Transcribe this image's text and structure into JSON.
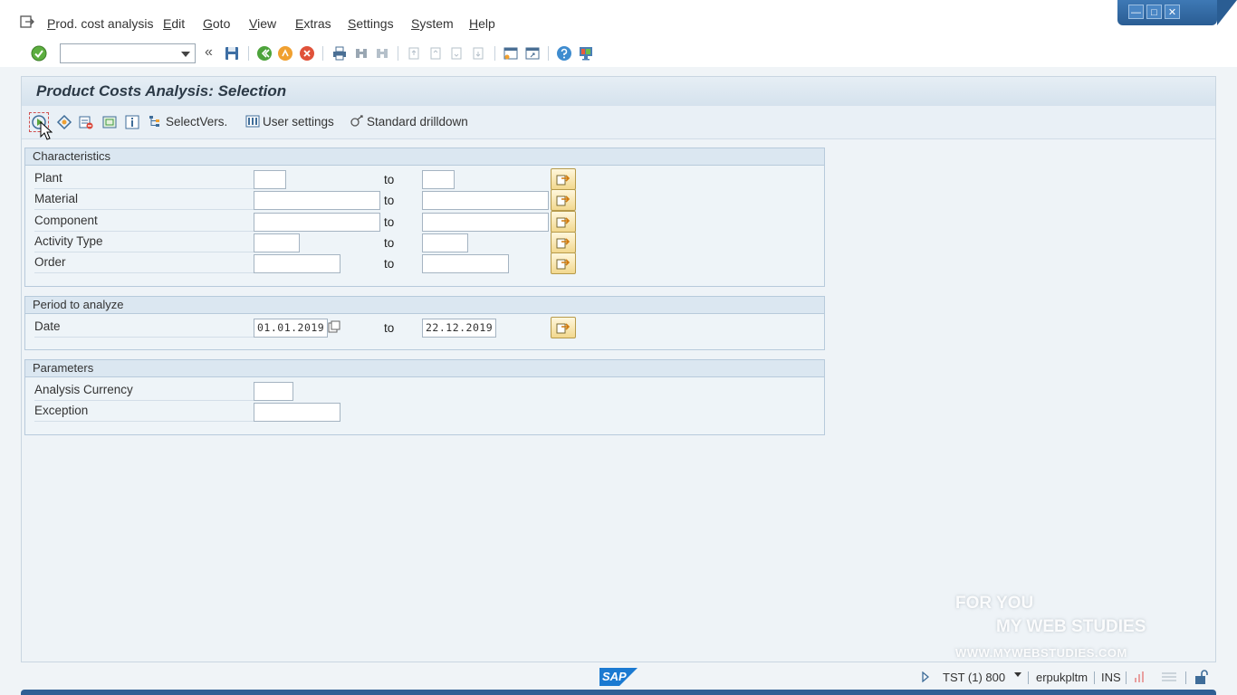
{
  "menubar": {
    "items": [
      "Prod. cost analysis",
      "Edit",
      "Goto",
      "View",
      "Extras",
      "Settings",
      "System",
      "Help"
    ]
  },
  "window_controls": {
    "minimize": "—",
    "maximize": "□",
    "close": "✕"
  },
  "systoolbar": {
    "command_field_value": "",
    "nav_glyph": "«"
  },
  "page": {
    "title": "Product Costs Analysis: Selection"
  },
  "apptoolbar": {
    "select_versions": "SelectVers.",
    "user_settings": "User settings",
    "standard_drilldown": "Standard drilldown"
  },
  "characteristics": {
    "heading": "Characteristics",
    "to_label": "to",
    "rows": [
      {
        "label": "Plant",
        "from": "",
        "to": ""
      },
      {
        "label": "Material",
        "from": "",
        "to": ""
      },
      {
        "label": "Component",
        "from": "",
        "to": ""
      },
      {
        "label": "Activity Type",
        "from": "",
        "to": ""
      },
      {
        "label": "Order",
        "from": "",
        "to": ""
      }
    ]
  },
  "period": {
    "heading": "Period to analyze",
    "label": "Date",
    "from": "01.01.2019",
    "to_label": "to",
    "to": "22.12.2019"
  },
  "parameters": {
    "heading": "Parameters",
    "rows": [
      {
        "label": "Analysis Currency",
        "value": ""
      },
      {
        "label": "Exception",
        "value": ""
      }
    ]
  },
  "statusbar": {
    "logo": "SAP",
    "system": "TST (1) 800",
    "server": "erpukpltm",
    "mode": "INS"
  },
  "watermark": {
    "line1": "FOR YOU",
    "line2": "MY WEB STUDIES",
    "line3": "WWW.MYWEBSTUDIES.COM"
  },
  "colors": {
    "accent_blue": "#2f5f94",
    "multiselect_button": "#f2d88e",
    "ok_green": "#4caf50"
  }
}
